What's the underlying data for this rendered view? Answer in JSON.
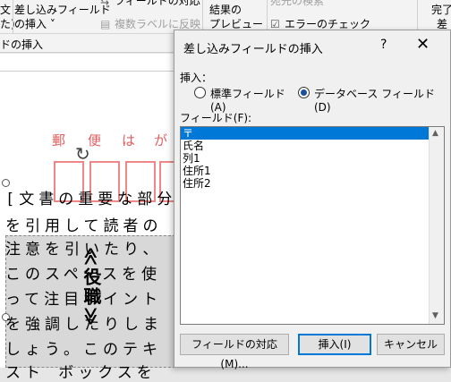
{
  "ribbon": {
    "col1_line1": "文",
    "col1_line2": "た)",
    "merge_line1": "差し込みフィールド",
    "merge_line2": "の挿入 ˅",
    "match_fields": "フィールドの対応",
    "multi_label": "複数ラベルに反映",
    "recipients_search": "宛先の検索",
    "preview_line1": "結果の",
    "preview_line2": "プレビュー",
    "error_check": "エラーのチェック",
    "finish_line1": "完了",
    "finish_line2": "差",
    "group_label": "ドの挿入"
  },
  "document": {
    "postal_chars": [
      "郵",
      "便",
      "は",
      "が"
    ],
    "lines": [
      "[文書の重要な部分",
      "を引用して読者の",
      "注意を引いたり、",
      "このスペースを使",
      "って注目ポイント",
      "を強調したりしま",
      "しょう。このテキ",
      "スト ボックスを"
    ],
    "vertical_text": "≪役職≫"
  },
  "dialog": {
    "title": "差し込みフィールドの挿入",
    "help": "?",
    "close": "✕",
    "insert_label": "挿入：",
    "radio_standard": "標準フィールド(A)",
    "radio_database": "データベース フィールド(D)",
    "selected_radio": "database",
    "fields_label": "フィールド(F):",
    "fields": [
      "〒",
      "氏名",
      "列1",
      "住所1",
      "住所2"
    ],
    "selected_field": "〒",
    "btn_match": "フィールドの対応(M)...",
    "btn_insert": "挿入(I)",
    "btn_cancel": "キャンセル"
  }
}
